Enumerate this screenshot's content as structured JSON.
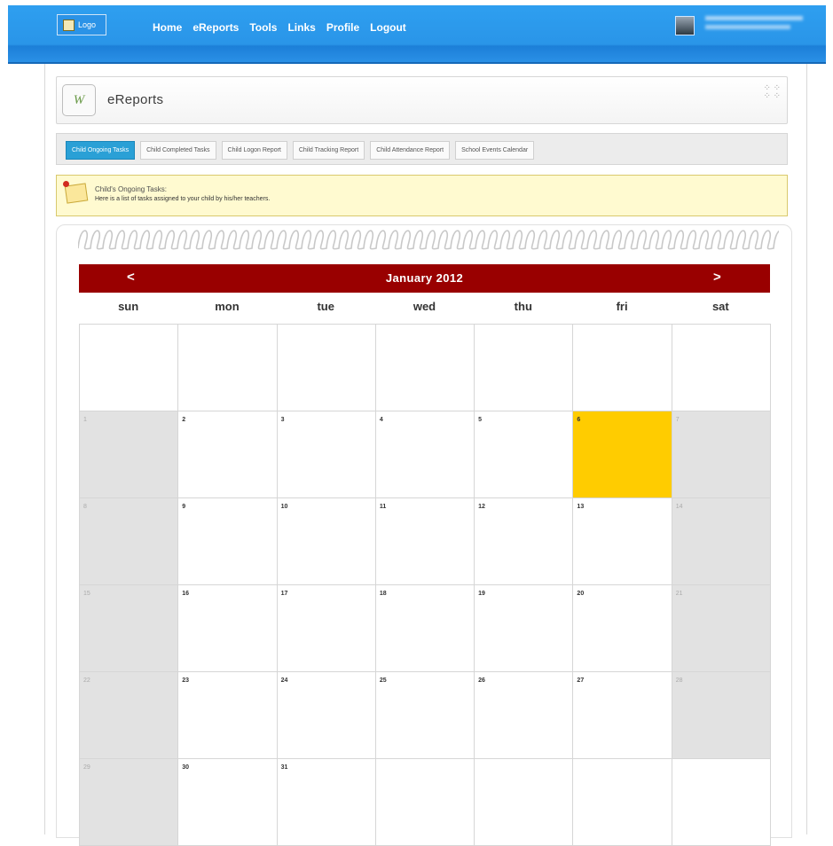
{
  "topbar": {
    "logo": "Logo",
    "nav": [
      "Home",
      "eReports",
      "Tools",
      "Links",
      "Profile",
      "Logout"
    ]
  },
  "app": {
    "title": "eReports",
    "tools_glyphs": "⁘ ⁘"
  },
  "tabs": [
    {
      "label": "Child Ongoing Tasks",
      "active": true
    },
    {
      "label": "Child Completed Tasks",
      "active": false
    },
    {
      "label": "Child Logon Report",
      "active": false
    },
    {
      "label": "Child Tracking Report",
      "active": false
    },
    {
      "label": "Child Attendance Report",
      "active": false
    },
    {
      "label": "School Events Calendar",
      "active": false
    }
  ],
  "notice": {
    "title": "Child's Ongoing Tasks:",
    "text": "Here is a list of tasks assigned to your child by his/her teachers."
  },
  "calendar": {
    "prev": "<",
    "next": ">",
    "month": "January 2012",
    "weekdays": [
      "sun",
      "mon",
      "tue",
      "wed",
      "thu",
      "fri",
      "sat"
    ],
    "today": 6,
    "accent": "#990000",
    "highlight": "#ffcc00",
    "rows": [
      [
        "",
        "",
        "",
        "",
        "",
        "",
        ""
      ],
      [
        "1",
        "2",
        "3",
        "4",
        "5",
        "6",
        "7"
      ],
      [
        "8",
        "9",
        "10",
        "11",
        "12",
        "13",
        "14"
      ],
      [
        "15",
        "16",
        "17",
        "18",
        "19",
        "20",
        "21"
      ],
      [
        "22",
        "23",
        "24",
        "25",
        "26",
        "27",
        "28"
      ],
      [
        "29",
        "30",
        "31",
        "",
        "",
        "",
        ""
      ]
    ]
  }
}
